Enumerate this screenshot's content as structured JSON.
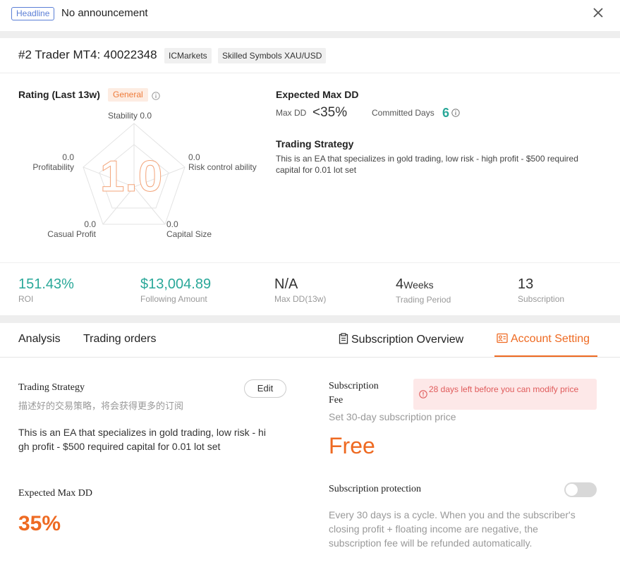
{
  "announcement": {
    "tag": "Headline",
    "text": "No announcement"
  },
  "trader": {
    "title": "#2 Trader MT4: 40022348",
    "broker": "ICMarkets",
    "symbols": "Skilled Symbols XAU/USD"
  },
  "rating": {
    "title": "Rating (Last 13w)",
    "level": "General",
    "score": "1.0",
    "axes": [
      {
        "name": "Stability",
        "value": "0.0"
      },
      {
        "name": "Risk control ability",
        "value": "0.0"
      },
      {
        "name": "Capital Size",
        "value": "0.0"
      },
      {
        "name": "Casual Profit",
        "value": "0.0"
      },
      {
        "name": "Profitability",
        "value": "0.0"
      }
    ]
  },
  "expected_dd": {
    "title": "Expected Max DD",
    "max_dd_label": "Max DD",
    "max_dd_value": "<35%",
    "committed_label": "Committed Days",
    "committed_value": "6"
  },
  "strategy": {
    "title": "Trading Strategy",
    "text": "This is an EA that specializes in gold trading, low risk - high profit - $500 required capital for 0.01 lot set"
  },
  "stats": [
    {
      "value": "151.43%",
      "label": "ROI"
    },
    {
      "value": "$13,004.89",
      "label": "Following Amount"
    },
    {
      "value": "N/A",
      "label": "Max DD(13w)"
    },
    {
      "value": "4",
      "unit": "Weeks",
      "label": "Trading Period"
    },
    {
      "value": "13",
      "label": "Subscription"
    }
  ],
  "tabs": {
    "analysis": "Analysis",
    "orders": "Trading orders",
    "overview": "Subscription Overview",
    "account": "Account Setting"
  },
  "account": {
    "strategy_label": "Trading Strategy",
    "strategy_hint": "描述好的交易策略，将会获得更多的订阅",
    "edit_label": "Edit",
    "strategy_line1": "This is an EA that specializes in gold trading, low risk - hi",
    "strategy_line2": "gh profit - $500 required capital for 0.01 lot set",
    "dd_label": "Expected Max DD",
    "dd_value": "35%",
    "fee_label_1": "Subscription",
    "fee_label_2": "Fee",
    "warning": "28 days left before you can modify price",
    "fee_hint": "Set 30-day subscription price",
    "fee_value": "Free",
    "protection_label": "Subscription protection",
    "protection_enabled": false,
    "protection_line1": "Every 30 days is a cycle. When you and the subscriber's",
    "protection_line2": "closing profit + floating income are negative, the",
    "protection_line3": "subscription fee will be refunded automatically."
  },
  "colors": {
    "accent": "#ee6a22",
    "teal": "#2aa899",
    "tag_blue": "#5b7fd6",
    "warning_bg": "#fde8e8"
  }
}
